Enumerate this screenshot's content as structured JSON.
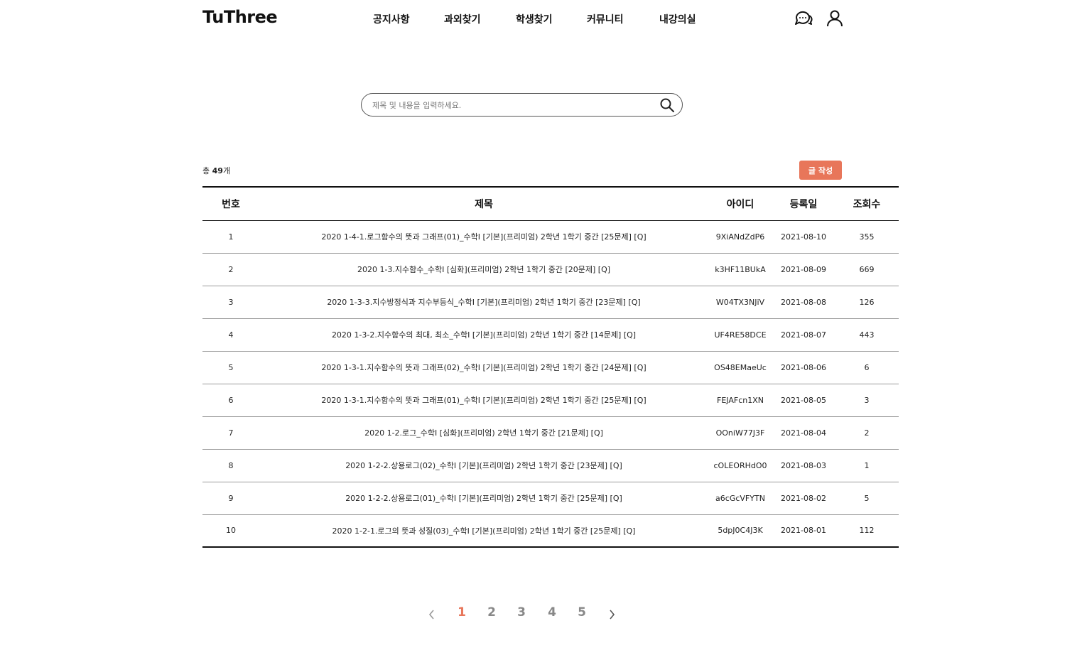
{
  "header": {
    "logo": "TuThree",
    "nav": [
      "공지사항",
      "과외찾기",
      "학생찾기",
      "커뮤니티",
      "내강의실"
    ],
    "icons": [
      "chat-icon",
      "user-icon"
    ]
  },
  "search": {
    "placeholder": "제목 및 내용을 입력하세요."
  },
  "summary": {
    "prefix": "총 ",
    "count": "49",
    "suffix": "개"
  },
  "write_button": "글 작성",
  "table": {
    "headers": [
      "번호",
      "제목",
      "아이디",
      "등록일",
      "조회수"
    ],
    "rows": [
      [
        "1",
        "2020 1-4-1.로그함수의 뜻과 그래프(01)_수학I [기본](프리미엄) 2학년 1학기 중간 [25문제] [Q]",
        "9XiANdZdP6",
        "2021-08-10",
        "355"
      ],
      [
        "2",
        "2020 1-3.지수함수_수학I [심화](프리미엄) 2학년 1학기 중간 [20문제] [Q]",
        "k3HF11BUkA",
        "2021-08-09",
        "669"
      ],
      [
        "3",
        "2020 1-3-3.지수방정식과 지수부등식_수학I [기본](프리미엄) 2학년 1학기 중간 [23문제] [Q]",
        "W04TX3NJiV",
        "2021-08-08",
        "126"
      ],
      [
        "4",
        "2020 1-3-2.지수함수의 최대, 최소_수학I [기본](프리미엄) 2학년 1학기 중간 [14문제] [Q]",
        "UF4RE58DCE",
        "2021-08-07",
        "443"
      ],
      [
        "5",
        "2020 1-3-1.지수함수의 뜻과 그래프(02)_수학I [기본](프리미엄) 2학년 1학기 중간 [24문제] [Q]",
        "OS48EMaeUc",
        "2021-08-06",
        "6"
      ],
      [
        "6",
        "2020 1-3-1.지수함수의 뜻과 그래프(01)_수학I [기본](프리미엄) 2학년 1학기 중간 [25문제] [Q]",
        "FEJAFcn1XN",
        "2021-08-05",
        "3"
      ],
      [
        "7",
        "2020 1-2.로그_수학I [심화](프리미엄) 2학년 1학기 중간 [21문제] [Q]",
        "OOniW77J3F",
        "2021-08-04",
        "2"
      ],
      [
        "8",
        "2020 1-2-2.상용로그(02)_수학I [기본](프리미엄) 2학년 1학기 중간 [23문제] [Q]",
        "cOLEORHdO0",
        "2021-08-03",
        "1"
      ],
      [
        "9",
        "2020 1-2-2.상용로그(01)_수학I [기본](프리미엄) 2학년 1학기 중간 [25문제] [Q]",
        "a6cGcVFYTN",
        "2021-08-02",
        "5"
      ],
      [
        "10",
        "2020 1-2-1.로그의 뜻과 성질(03)_수학I [기본](프리미엄) 2학년 1학기 중간 [25문제] [Q]",
        "5dpJ0C4J3K",
        "2021-08-01",
        "112"
      ]
    ]
  },
  "pagination": {
    "pages": [
      "1",
      "2",
      "3",
      "4",
      "5"
    ],
    "current": "1",
    "prev_icon": "chevron-left-icon",
    "next_icon": "chevron-right-icon"
  },
  "colors": {
    "accent": "#e8765a",
    "text": "#222222",
    "border": "#111111"
  }
}
